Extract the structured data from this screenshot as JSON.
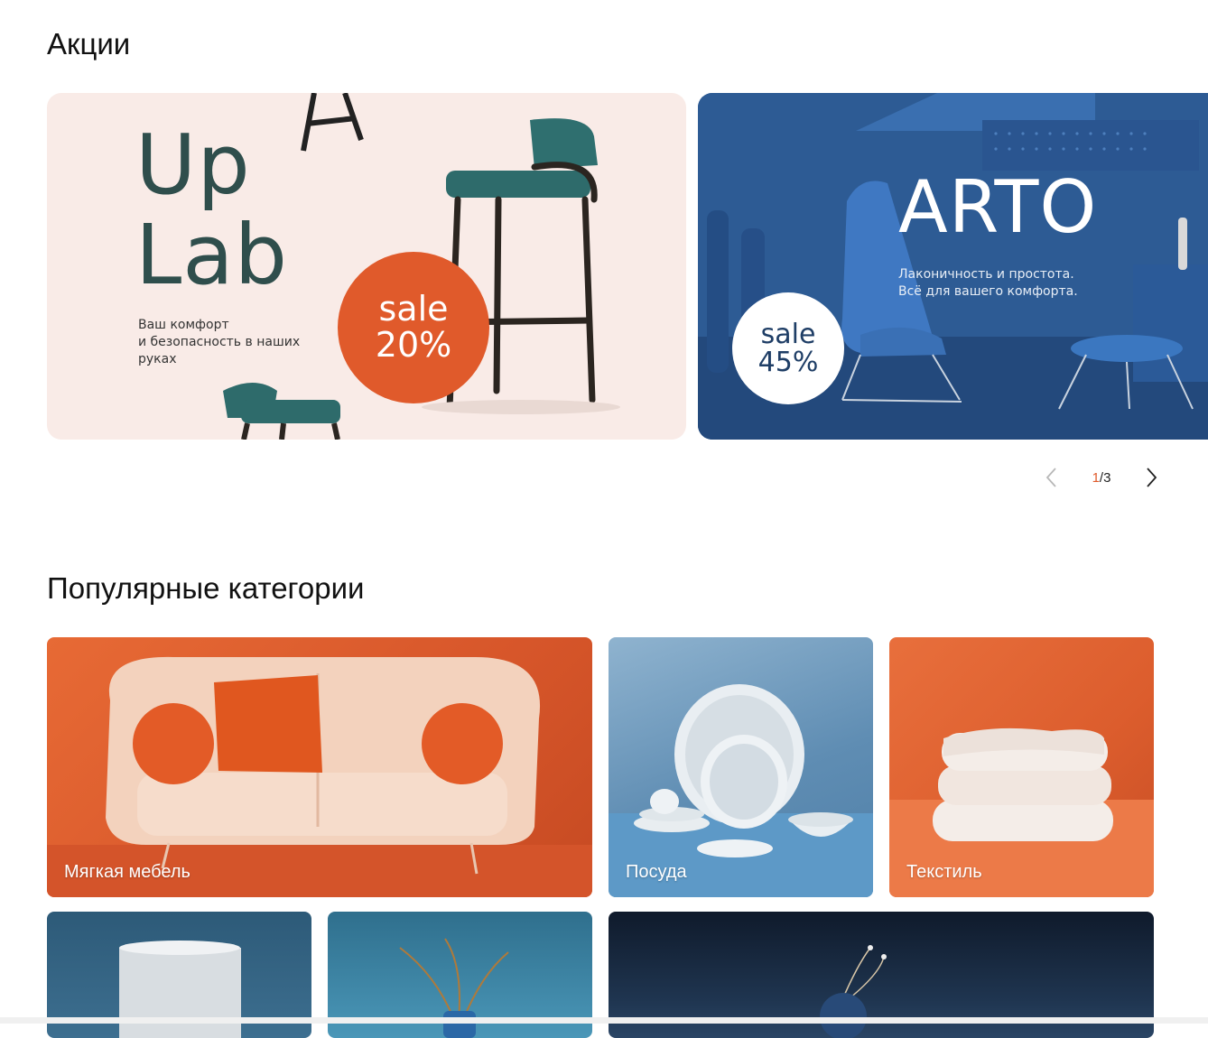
{
  "promotions": {
    "title": "Акции",
    "banners": [
      {
        "brand_line1": "Up",
        "brand_line2": "Lab",
        "text_lines": [
          "Ваш комфорт",
          "и безопасность в наших",
          "руках"
        ],
        "sale_label": "sale",
        "sale_value": "20%"
      },
      {
        "brand": "ARTO",
        "text_lines": [
          "Лаконичность и простота.",
          "Всё для вашего комфорта."
        ],
        "sale_label": "sale",
        "sale_value": "45%"
      }
    ],
    "pager": {
      "current": "1",
      "separator": "/",
      "total": "3",
      "prev_icon": "chevron-left-icon",
      "next_icon": "chevron-right-icon"
    }
  },
  "categories": {
    "title": "Популярные категории",
    "items": [
      {
        "label": "Мягкая мебель"
      },
      {
        "label": "Посуда"
      },
      {
        "label": "Текстиль"
      }
    ]
  },
  "colors": {
    "accent": "#e05a2b",
    "uplab_bg": "#f9ebe7",
    "arto_bg": "#2f5c96",
    "uplab_brand": "#2f4e4c"
  }
}
